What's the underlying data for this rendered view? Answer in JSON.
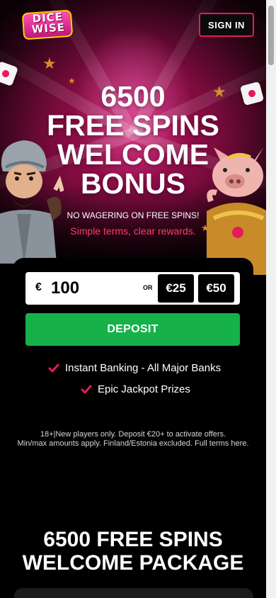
{
  "header": {
    "logo_line1": "DICE",
    "logo_line2": "WISE",
    "signin_label": "SIGN IN"
  },
  "hero": {
    "title_lines": [
      "6500",
      "FREE SPINS",
      "WELCOME",
      "BONUS"
    ],
    "subtitle": "NO WAGERING ON FREE SPINS!",
    "tagline": "Simple terms, clear rewards."
  },
  "deposit_form": {
    "currency_symbol": "€",
    "amount_value": "100",
    "or_label": "OR",
    "quick_amounts": [
      "€25",
      "€50"
    ],
    "deposit_label": "DEPOSIT"
  },
  "features": [
    "Instant Banking - All Major Banks",
    "Epic Jackpot Prizes"
  ],
  "terms": {
    "line1": "18+|New players only. Deposit €20+ to activate offers.",
    "line2": "Min/max amounts apply. Finland/Estonia excluded. Full terms here."
  },
  "package": {
    "title_line1": "6500 FREE SPINS",
    "title_line2": "WELCOME PACKAGE"
  },
  "colors": {
    "accent_pink": "#e8185c",
    "deposit_green": "#17b14a",
    "tagline_red": "#ff3d6a",
    "check_red": "#e8185c"
  },
  "icons": {
    "check": "check-icon",
    "star": "star-icon",
    "dice": "dice-icon"
  }
}
